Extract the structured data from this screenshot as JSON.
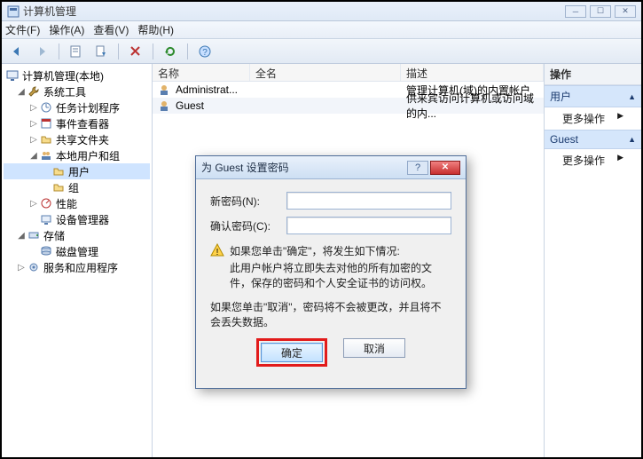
{
  "window": {
    "title": "计算机管理"
  },
  "menubar": {
    "file": "文件(F)",
    "action": "操作(A)",
    "view": "查看(V)",
    "help": "帮助(H)"
  },
  "tree": {
    "root": "计算机管理(本地)",
    "sys_tools": "系统工具",
    "task_sched": "任务计划程序",
    "event_viewer": "事件查看器",
    "shared": "共享文件夹",
    "local_users": "本地用户和组",
    "users": "用户",
    "groups": "组",
    "perf": "性能",
    "devmgr": "设备管理器",
    "storage": "存储",
    "diskmgmt": "磁盘管理",
    "services_apps": "服务和应用程序"
  },
  "list": {
    "cols": {
      "name": "名称",
      "fullname": "全名",
      "desc": "描述"
    },
    "rows": [
      {
        "name": "Administrat...",
        "fullname": "",
        "desc": "管理计算机(域)的内置帐户"
      },
      {
        "name": "Guest",
        "fullname": "",
        "desc": "供来宾访问计算机或访问域的内..."
      }
    ]
  },
  "actions": {
    "panel_title": "操作",
    "group1": "用户",
    "more1": "更多操作",
    "group2": "Guest",
    "more2": "更多操作"
  },
  "dialog": {
    "title": "为 Guest 设置密码",
    "new_label": "新密码(N):",
    "confirm_label": "确认密码(C):",
    "warn1": "如果您单击\"确定\"，将发生如下情况:",
    "warn2": "此用户帐户将立即失去对他的所有加密的文件，保存的密码和个人安全证书的访问权。",
    "info": "如果您单击\"取消\"，密码将不会被更改，并且将不会丢失数据。",
    "ok": "确定",
    "cancel": "取消"
  }
}
